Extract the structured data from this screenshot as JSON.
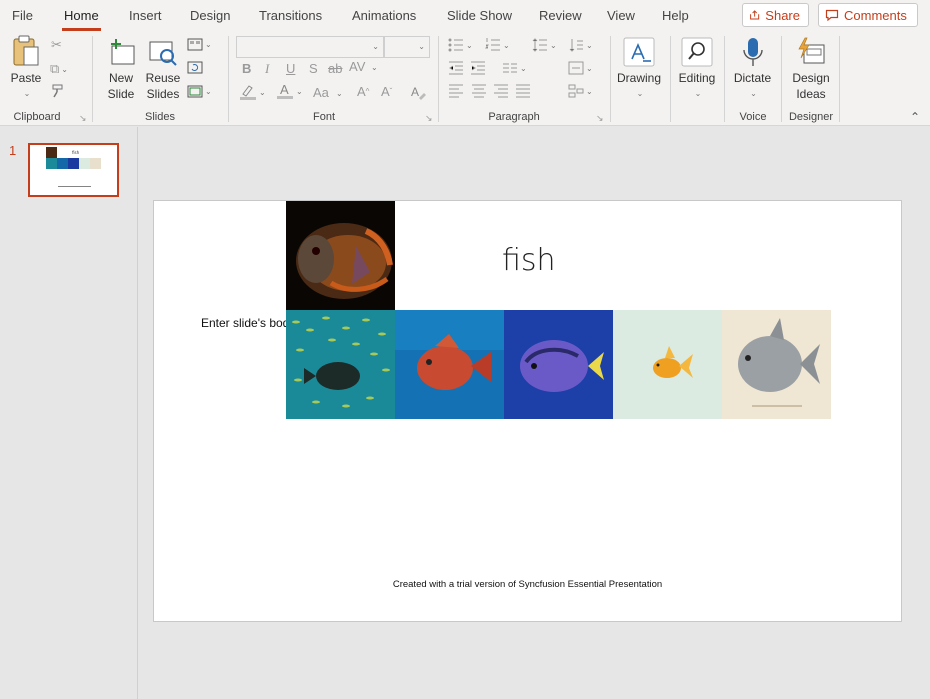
{
  "tabs": [
    "File",
    "Home",
    "Insert",
    "Design",
    "Transitions",
    "Animations",
    "Slide Show",
    "Review",
    "View",
    "Help"
  ],
  "active_tab": "Home",
  "share_label": "Share",
  "comments_label": "Comments",
  "ribbon": {
    "clipboard": {
      "label": "Clipboard",
      "paste": "Paste"
    },
    "slides": {
      "label": "Slides",
      "new_slide_1": "New",
      "new_slide_2": "Slide",
      "reuse_1": "Reuse",
      "reuse_2": "Slides"
    },
    "font": {
      "label": "Font",
      "bold": "B",
      "italic": "I",
      "underline": "U",
      "shadow": "S",
      "strike": "ab",
      "spacing": "AV",
      "case": "Aa"
    },
    "paragraph": {
      "label": "Paragraph"
    },
    "drawing": "Drawing",
    "editing": "Editing",
    "voice": {
      "label": "Voice",
      "dictate": "Dictate"
    },
    "designer": {
      "label": "Designer",
      "design_ideas_1": "Design",
      "design_ideas_2": "Ideas"
    }
  },
  "thumbnail": {
    "number": "1"
  },
  "slide": {
    "title": "fish",
    "body": "Enter slide's body",
    "footer": "Created with a trial version of Syncfusion Essential Presentation"
  },
  "colors": {
    "accent": "#c43e1c",
    "ribbon_bg": "#f3f2f1",
    "pane_bg": "#e6e6e6"
  }
}
